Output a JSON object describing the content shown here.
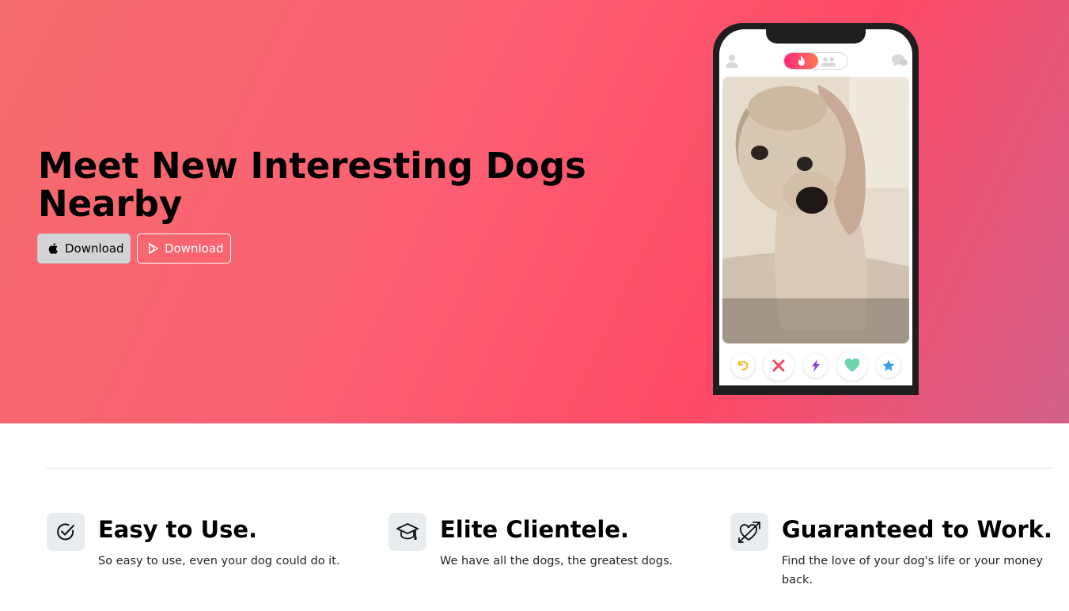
{
  "hero": {
    "title": "Meet New Interesting Dogs Nearby",
    "buttons": [
      {
        "label": "Download",
        "icon": "apple-icon"
      },
      {
        "label": "Download",
        "icon": "play-store-icon"
      }
    ],
    "gradient_colors": [
      "#f56c6c",
      "#fe4a66",
      "#d2618a"
    ]
  },
  "phone": {
    "toggle_active_icon": "flame-icon",
    "toggle_inactive_icon": "group-icon",
    "card_image": "dog-photo",
    "action_buttons": [
      "rewind-icon",
      "nope-x-icon",
      "boost-bolt-icon",
      "like-heart-icon",
      "super-like-star-icon"
    ]
  },
  "features": [
    {
      "icon": "check-circle-icon",
      "title": "Easy to Use.",
      "text": "So easy to use, even your dog could do it."
    },
    {
      "icon": "graduation-cap-icon",
      "title": "Elite Clientele.",
      "text": "We have all the dogs, the greatest dogs."
    },
    {
      "icon": "heart-arrow-icon",
      "title": "Guaranteed to Work.",
      "text": "Find the love of your dog's life or your money back."
    }
  ]
}
